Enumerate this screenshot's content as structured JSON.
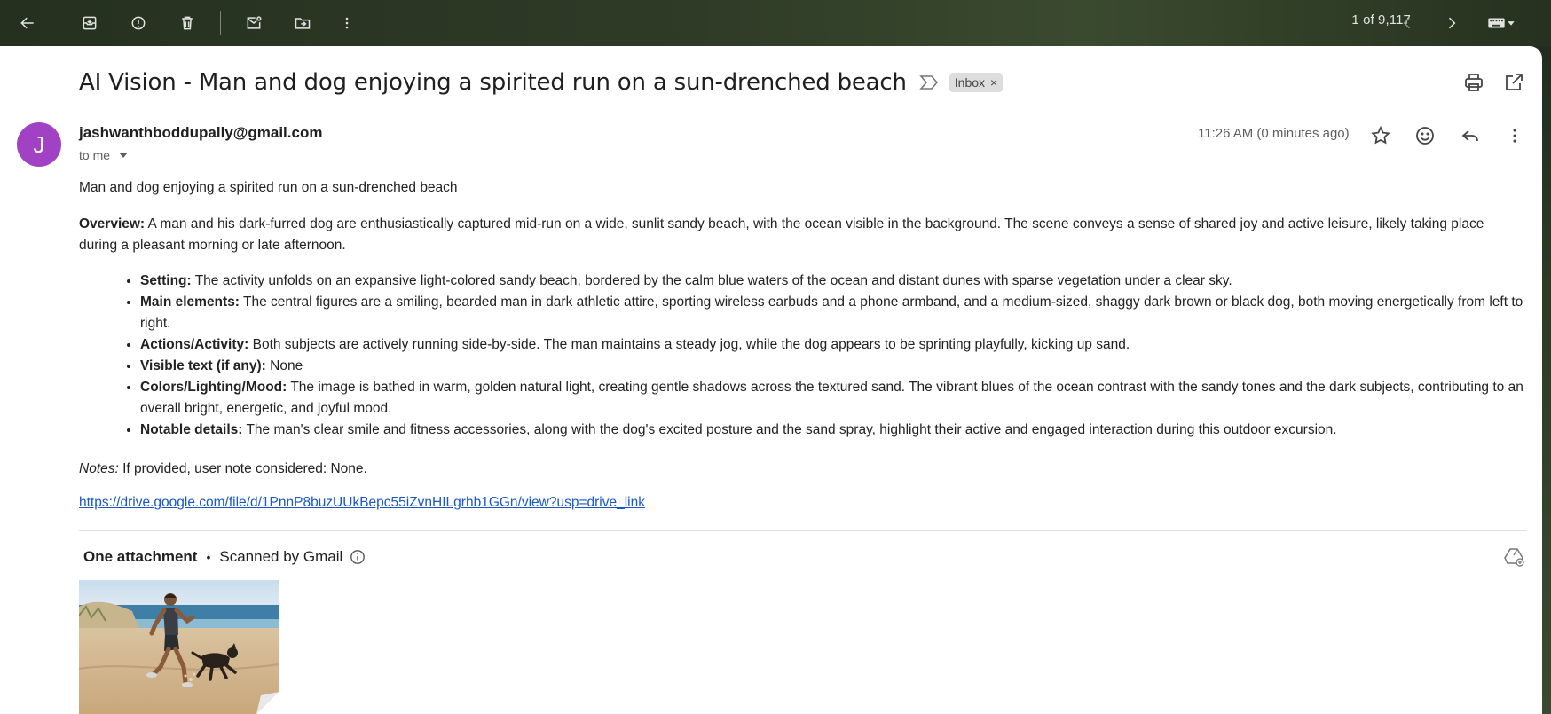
{
  "toolbar": {
    "pager": "1 of 9,117"
  },
  "message": {
    "subject": "AI Vision - Man and dog enjoying a spirited run on a sun-drenched beach",
    "label": "Inbox",
    "label_remove": "×",
    "avatar_letter": "J",
    "sender": "jashwanthboddupally@gmail.com",
    "recipient": "to me",
    "timestamp": "11:26 AM (0 minutes ago)",
    "avatar_color": "#a142c4"
  },
  "body": {
    "intro": "Man and dog enjoying a spirited run on a sun-drenched beach",
    "overview_label": "Overview:",
    "overview_text": " A man and his dark-furred dog are enthusiastically captured mid-run on a wide, sunlit sandy beach, with the ocean visible in the background. The scene conveys a sense of shared joy and active leisure, likely taking place during a pleasant morning or late afternoon.",
    "bullets": [
      {
        "label": "Setting:",
        "text": " The activity unfolds on an expansive light-colored sandy beach, bordered by the calm blue waters of the ocean and distant dunes with sparse vegetation under a clear sky."
      },
      {
        "label": "Main elements:",
        "text": " The central figures are a smiling, bearded man in dark athletic attire, sporting wireless earbuds and a phone armband, and a medium-sized, shaggy dark brown or black dog, both moving energetically from left to right."
      },
      {
        "label": "Actions/Activity:",
        "text": " Both subjects are actively running side-by-side. The man maintains a steady jog, while the dog appears to be sprinting playfully, kicking up sand."
      },
      {
        "label": "Visible text (if any):",
        "text": " None"
      },
      {
        "label": "Colors/Lighting/Mood:",
        "text": " The image is bathed in warm, golden natural light, creating gentle shadows across the textured sand. The vibrant blues of the ocean contrast with the sandy tones and the dark subjects, contributing to an overall bright, energetic, and joyful mood."
      },
      {
        "label": "Notable details:",
        "text": " The man's clear smile and fitness accessories, along with the dog's excited posture and the sand spray, highlight their active and engaged interaction during this outdoor excursion."
      }
    ],
    "notes_label": "Notes:",
    "notes_text": " If provided, user note considered: None.",
    "link": "https://drive.google.com/file/d/1PnnP8buzUUkBepc55iZvnHILgrhb1GGn/view?usp=drive_link"
  },
  "attachments": {
    "title": "One attachment",
    "separator": "•",
    "scanned": "Scanned by Gmail"
  },
  "icons": {
    "toolbar": [
      "back-arrow-icon",
      "archive-icon",
      "report-spam-icon",
      "delete-icon",
      "mark-unread-icon",
      "move-to-icon",
      "more-vert-icon",
      "newer-icon",
      "older-icon",
      "keyboard-icon"
    ],
    "header": [
      "print-icon",
      "open-in-new-window-icon",
      "star-icon",
      "emoji-icon",
      "reply-icon",
      "more-vert-icon"
    ]
  }
}
